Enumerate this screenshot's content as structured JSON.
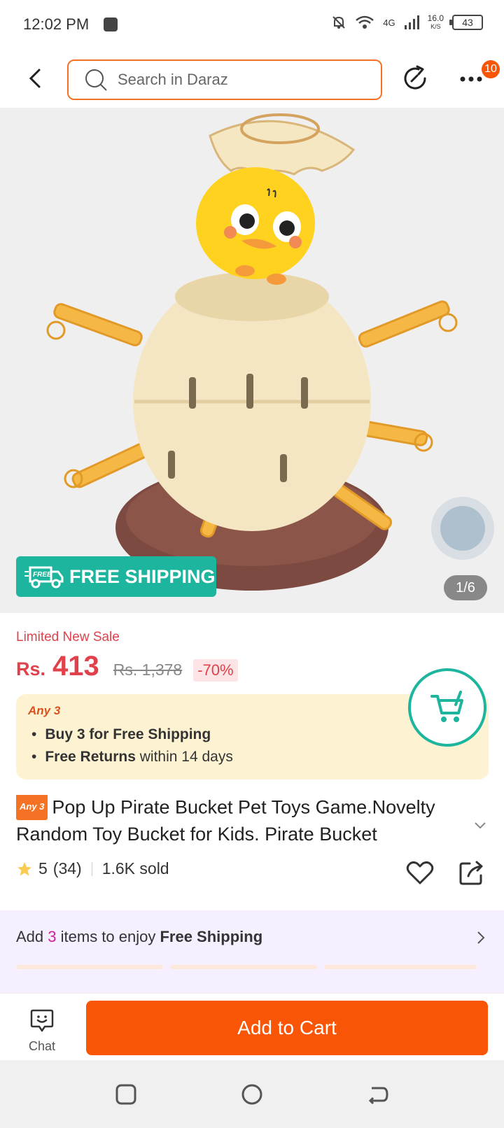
{
  "status_bar": {
    "time": "12:02 PM",
    "network": "4G",
    "speed_value": "16.0",
    "speed_unit": "K/S",
    "battery": "43"
  },
  "header": {
    "search_placeholder": "Search in Daraz",
    "cart_badge": "10"
  },
  "hero": {
    "shipping_badge": "FREE SHIPPING",
    "shipping_icon_text": "FREE",
    "image_counter": "1/6"
  },
  "pricing": {
    "sale_label": "Limited New Sale",
    "currency": "Rs.",
    "price": "413",
    "original_price": "Rs. 1,378",
    "discount": "-70%"
  },
  "promo": {
    "tag": "Any 3",
    "items": [
      {
        "bold": "Buy 3 for  Free Shipping",
        "rest": ""
      },
      {
        "bold": "Free Returns",
        "rest": " within 14 days"
      }
    ]
  },
  "product": {
    "badge": "Any 3",
    "title": "Pop Up Pirate Bucket Pet Toys Game.Novelty Random Toy Bucket for Kids. Pirate Bucket",
    "rating": "5",
    "reviews": "(34)",
    "sold": "1.6K sold"
  },
  "shipping_prompt": {
    "prefix": "Add ",
    "count": "3",
    "middle": " items to enjoy ",
    "bold": "Free Shipping"
  },
  "action_bar": {
    "chat_label": "Chat",
    "add_to_cart_label": "Add to Cart"
  },
  "colors": {
    "accent": "#f85606",
    "price_red": "#e0424b",
    "teal": "#1db59e"
  }
}
